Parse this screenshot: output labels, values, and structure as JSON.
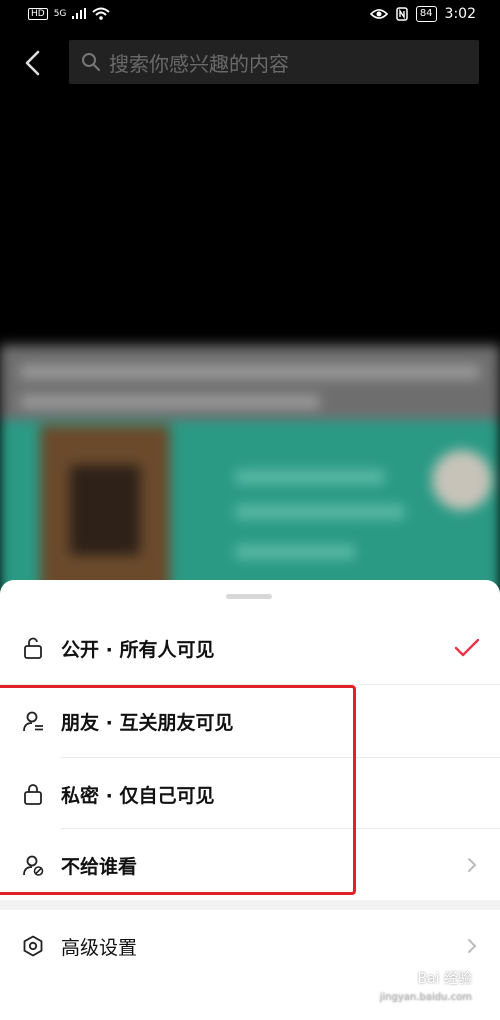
{
  "status_bar": {
    "hd": "HD",
    "network": "5G",
    "battery": "84",
    "time": "3:02"
  },
  "search": {
    "placeholder": "搜索你感兴趣的内容"
  },
  "privacy_sheet": {
    "options": [
      {
        "label": "公开 · 所有人可见",
        "icon": "unlock-icon",
        "selected": true
      },
      {
        "label": "朋友 · 互关朋友可见",
        "icon": "friends-icon",
        "selected": false
      },
      {
        "label": "私密 · 仅自己可见",
        "icon": "lock-icon",
        "selected": false
      },
      {
        "label": "不给谁看",
        "icon": "block-user-icon",
        "selected": false,
        "has_chevron": true
      }
    ],
    "advanced": {
      "label": "高级设置",
      "icon": "settings-icon"
    }
  },
  "colors": {
    "check": "#e8334a",
    "highlight": "#e0202a"
  },
  "watermark": {
    "text": "Bai 经验",
    "sub": "jingyan.baidu.com"
  }
}
